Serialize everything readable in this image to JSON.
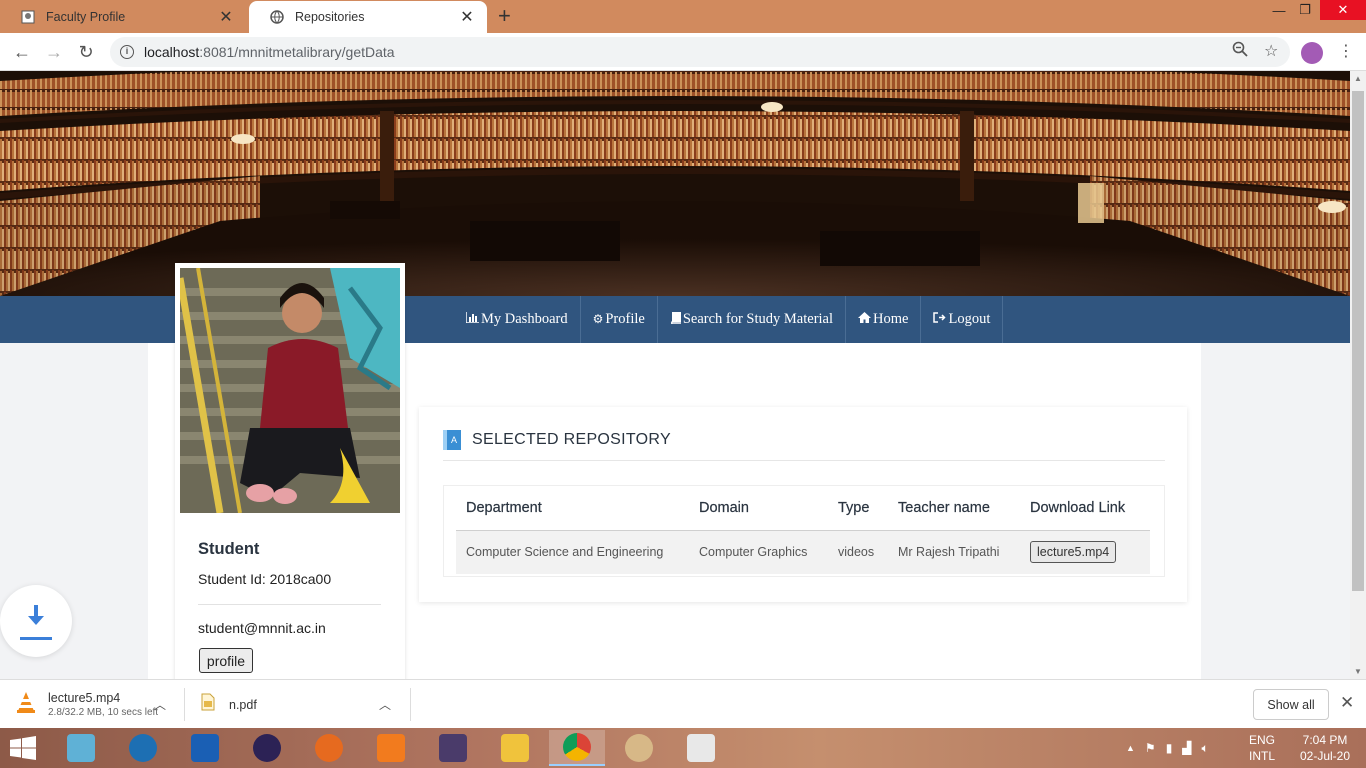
{
  "browser": {
    "tabs": [
      {
        "title": "Faculty Profile",
        "active": false
      },
      {
        "title": "Repositories",
        "active": true
      }
    ],
    "url_host": "localhost",
    "url_path": ":8081/mnnitmetalibrary/getData"
  },
  "navbar": {
    "items": [
      {
        "label": "My Dashboard",
        "icon": "bar-chart-icon"
      },
      {
        "label": "Profile",
        "icon": "gears-icon"
      },
      {
        "label": "Search for Study Material",
        "icon": "book-icon"
      },
      {
        "label": "Home",
        "icon": "home-icon"
      },
      {
        "label": "Logout",
        "icon": "sign-out-icon"
      }
    ]
  },
  "profile": {
    "role": "Student",
    "student_id": "Student Id: 2018ca00",
    "email": "student@mnnit.ac.in",
    "button_label": "profile"
  },
  "repository": {
    "heading": "SELECTED REPOSITORY",
    "columns": [
      "Department",
      "Domain",
      "Type",
      "Teacher name",
      "Download Link"
    ],
    "rows": [
      {
        "department": "Computer Science and Engineering",
        "domain": "Computer Graphics",
        "type": "videos",
        "teacher": "Mr Rajesh Tripathi",
        "download": "lecture5.mp4"
      }
    ]
  },
  "downloads": {
    "items": [
      {
        "name": "lecture5.mp4",
        "status": "2.8/32.2 MB, 10 secs left"
      },
      {
        "name": "n.pdf",
        "status": ""
      }
    ],
    "show_all": "Show all"
  },
  "taskbar": {
    "language_top": "ENG",
    "language_bottom": "INTL",
    "time": "7:04 PM",
    "date": "02-Jul-20"
  },
  "colors": {
    "navbar": "#30557f",
    "tabbar": "#d18a5e",
    "accent": "#3a8fd4"
  }
}
